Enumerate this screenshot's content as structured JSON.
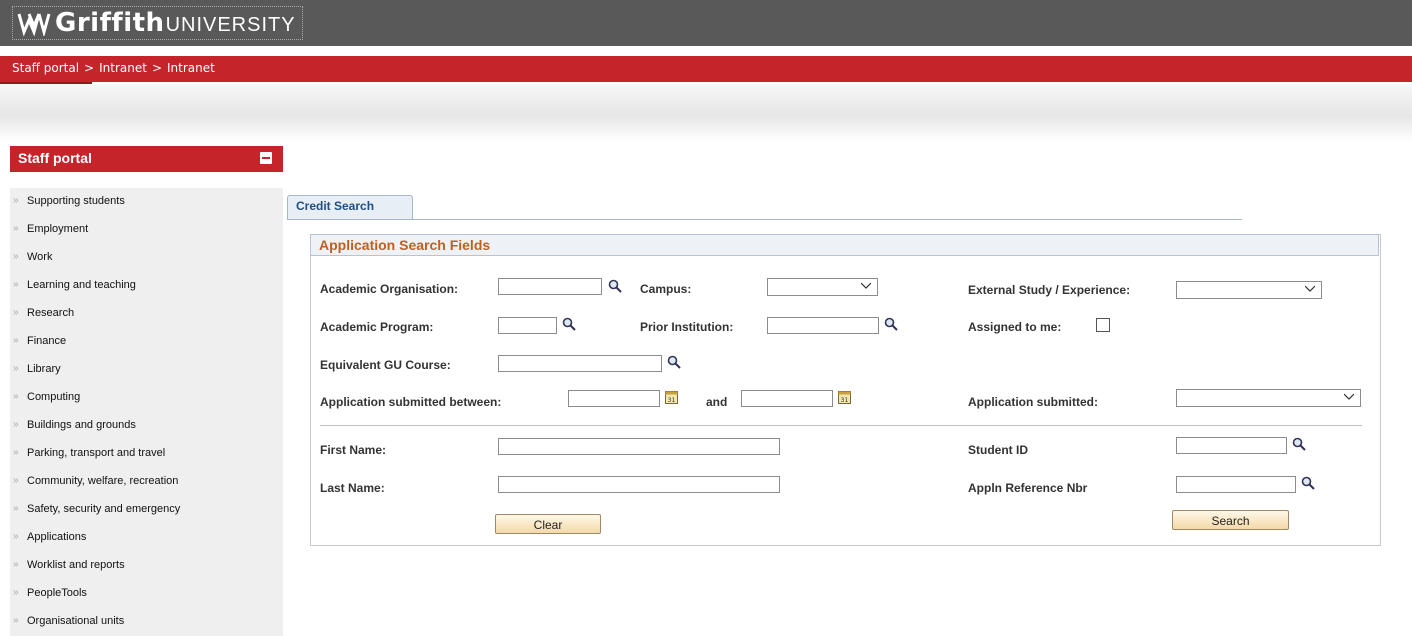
{
  "header": {
    "logo_brand": "Griffith",
    "logo_suffix": "UNIVERSITY",
    "breadcrumb": [
      "Staff portal",
      "Intranet",
      "Intranet"
    ],
    "breadcrumb_sep": ">"
  },
  "sidebar": {
    "title": "Staff portal",
    "items": [
      {
        "label": "Supporting students"
      },
      {
        "label": "Employment"
      },
      {
        "label": "Work"
      },
      {
        "label": "Learning and teaching"
      },
      {
        "label": "Research"
      },
      {
        "label": "Finance"
      },
      {
        "label": "Library"
      },
      {
        "label": "Computing"
      },
      {
        "label": "Buildings and grounds"
      },
      {
        "label": "Parking, transport and travel"
      },
      {
        "label": "Community, welfare, recreation"
      },
      {
        "label": "Safety, security and emergency"
      },
      {
        "label": "Applications"
      },
      {
        "label": "Worklist and reports"
      },
      {
        "label": "PeopleTools"
      },
      {
        "label": "Organisational units"
      }
    ]
  },
  "tab": {
    "label": "Credit Search"
  },
  "panel": {
    "title": "Application Search Fields",
    "fields": {
      "academic_organisation": "Academic Organisation:",
      "campus": "Campus:",
      "external_study": "External Study / Experience:",
      "academic_program": "Academic Program:",
      "prior_institution": "Prior Institution:",
      "assigned_to_me": "Assigned to me:",
      "equivalent_course": "Equivalent GU Course:",
      "submitted_between": "Application submitted between:",
      "and": "and",
      "application_submitted": "Application submitted:",
      "first_name": "First Name:",
      "student_id": "Student ID",
      "last_name": "Last Name:",
      "appln_ref": "Appln Reference Nbr"
    },
    "buttons": {
      "clear": "Clear",
      "search": "Search"
    }
  },
  "colors": {
    "brand_red": "#c6242b",
    "header_grey": "#595959",
    "title_orange": "#c06020"
  }
}
